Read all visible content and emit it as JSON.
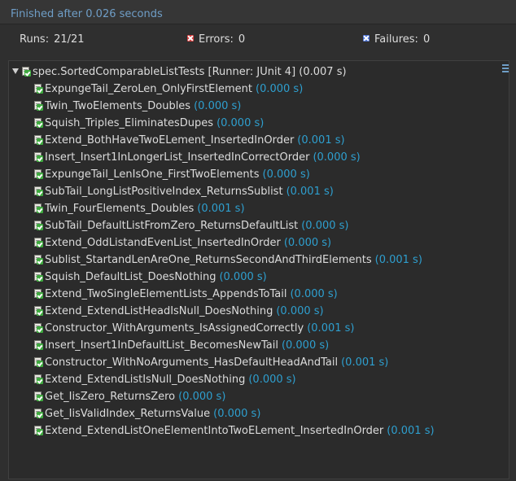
{
  "header": {
    "status": "Finished after 0.026 seconds"
  },
  "stats": {
    "runs_label": "Runs:",
    "runs_value": "21/21",
    "errors_label": "Errors:",
    "errors_value": "0",
    "failures_label": "Failures:",
    "failures_value": "0",
    "error_color": "#d23a3a",
    "failure_color": "#4a6fd0"
  },
  "suite": {
    "name": "spec.SortedComparableListTests [Runner: JUnit 4] (0.007 s)",
    "icon": "test-suite-pass-icon",
    "expanded": true
  },
  "tests": [
    {
      "name": "ExpungeTail_ZeroLen_OnlyFirstElement",
      "time": "(0.000 s)"
    },
    {
      "name": "Twin_TwoElements_Doubles",
      "time": "(0.000 s)"
    },
    {
      "name": "Squish_Triples_EliminatesDupes",
      "time": "(0.000 s)"
    },
    {
      "name": "Extend_BothHaveTwoELement_InsertedInOrder",
      "time": "(0.001 s)"
    },
    {
      "name": "Insert_Insert1InLongerList_InsertedInCorrectOrder",
      "time": "(0.000 s)"
    },
    {
      "name": "ExpungeTail_LenIsOne_FirstTwoElements",
      "time": "(0.000 s)"
    },
    {
      "name": "SubTail_LongListPositiveIndex_ReturnsSublist",
      "time": "(0.001 s)"
    },
    {
      "name": "Twin_FourElements_Doubles",
      "time": "(0.001 s)"
    },
    {
      "name": "SubTail_DefaultListFromZero_ReturnsDefaultList",
      "time": "(0.000 s)"
    },
    {
      "name": "Extend_OddListandEvenList_InsertedInOrder",
      "time": "(0.000 s)"
    },
    {
      "name": "Sublist_StartandLenAreOne_ReturnsSecondAndThirdElements",
      "time": "(0.001 s)"
    },
    {
      "name": "Squish_DefaultList_DoesNothing",
      "time": "(0.000 s)"
    },
    {
      "name": "Extend_TwoSingleElementLists_AppendsToTail",
      "time": "(0.000 s)"
    },
    {
      "name": "Extend_ExtendListHeadIsNull_DoesNothing",
      "time": "(0.000 s)"
    },
    {
      "name": "Constructor_WithArguments_IsAssignedCorrectly",
      "time": "(0.001 s)"
    },
    {
      "name": "Insert_Insert1InDefaultList_BecomesNewTail",
      "time": "(0.000 s)"
    },
    {
      "name": "Constructor_WithNoArguments_HasDefaultHeadAndTail",
      "time": "(0.001 s)"
    },
    {
      "name": "Extend_ExtendListIsNull_DoesNothing",
      "time": "(0.000 s)"
    },
    {
      "name": "Get_IisZero_ReturnsZero",
      "time": "(0.000 s)"
    },
    {
      "name": "Get_IisValidIndex_ReturnsValue",
      "time": "(0.000 s)"
    },
    {
      "name": "Extend_ExtendListOneElementIntoTwoELement_InsertedInOrder",
      "time": "(0.001 s)"
    }
  ],
  "colors": {
    "background": "#2f2f2f",
    "status_text": "#6f9ec7",
    "time_text": "#2e9fcf",
    "pass_green": "#3fa93f"
  }
}
